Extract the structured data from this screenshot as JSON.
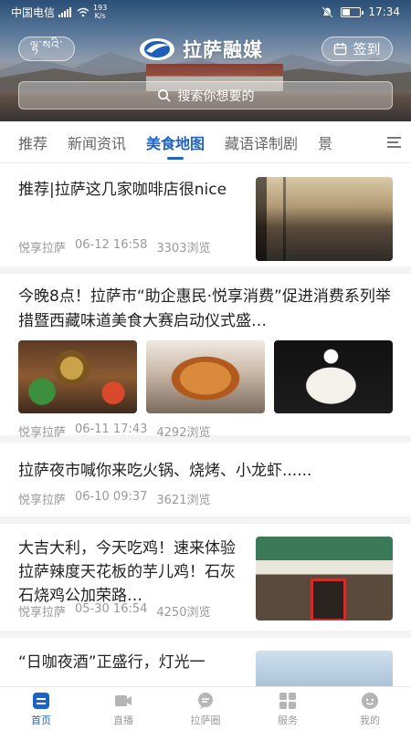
{
  "status_bar": {
    "carrier": "中国电信",
    "network": "2G",
    "speed_value": "193",
    "speed_unit": "K/s",
    "time": "17:34"
  },
  "header": {
    "tibetan_label": "ལྷ་སའི་",
    "app_title": "拉萨融媒",
    "signin_label": "签到"
  },
  "search": {
    "placeholder": "搜索你想要的"
  },
  "tabs": [
    {
      "label": "推荐",
      "active": false
    },
    {
      "label": "新闻资讯",
      "active": false
    },
    {
      "label": "美食地图",
      "active": true
    },
    {
      "label": "藏语译制剧",
      "active": false
    },
    {
      "label": "景",
      "active": false
    }
  ],
  "feed": {
    "item1": {
      "title": "推荐|拉萨这几家咖啡店很nice",
      "source": "悦享拉萨",
      "time": "06-12 16:58",
      "views": "3303浏览"
    },
    "item2": {
      "title": "今晚8点！拉萨市“助企惠民·悦享消费”促进消费系列举措暨西藏味道美食大赛启动仪式盛…",
      "source": "悦享拉萨",
      "time": "06-11 17:43",
      "views": "4292浏览"
    },
    "item3": {
      "title": "拉萨夜市喊你来吃火锅、烧烤、小龙虾......",
      "source": "悦享拉萨",
      "time": "06-10 09:37",
      "views": "3621浏览"
    },
    "item4": {
      "title": "大吉大利，今天吃鸡！速来体验拉萨辣度天花板的芋儿鸡！石灰石烧鸡公加荣路…",
      "source": "悦享拉萨",
      "time": "05-30 16:54",
      "views": "4250浏览"
    },
    "item5": {
      "title": "“日咖夜酒”正盛行，灯光一"
    }
  },
  "bottom_nav": [
    {
      "label": "首页",
      "icon": "home-icon",
      "active": true
    },
    {
      "label": "直播",
      "icon": "live-icon",
      "active": false
    },
    {
      "label": "拉萨圈",
      "icon": "chat-circle-icon",
      "active": false
    },
    {
      "label": "服务",
      "icon": "grid-icon",
      "active": false
    },
    {
      "label": "我的",
      "icon": "profile-icon",
      "active": false
    }
  ],
  "colors": {
    "accent": "#1f63c4",
    "muted_text": "#999999",
    "divider": "#f3f3f3"
  }
}
